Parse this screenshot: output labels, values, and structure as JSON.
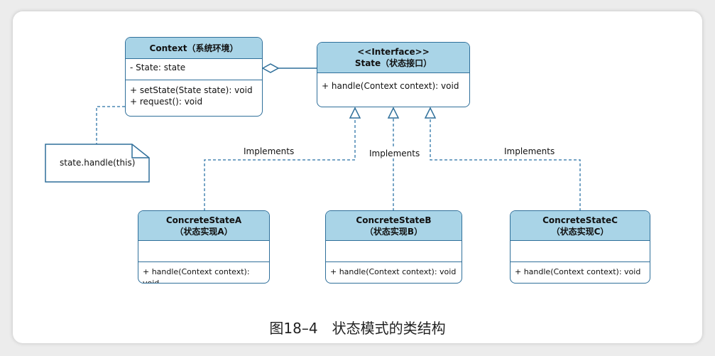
{
  "context": {
    "title": "Context（系统环境）",
    "attribute": "- State: state",
    "methods": [
      "+ setState(State state): void",
      "+ request(): void"
    ]
  },
  "state": {
    "stereotype": "<<Interface>>",
    "title": "State（状态接口）",
    "method": "+ handle(Context context): void"
  },
  "note": {
    "text": "state.handle(this)"
  },
  "implementations": [
    {
      "name": "ConcreteStateA",
      "subtitle": "（状态实现A）",
      "method": "+ handle(Context context): void",
      "edge_label": "Implements"
    },
    {
      "name": "ConcreteStateB",
      "subtitle": "（状态实现B）",
      "method": "+ handle(Context context): void",
      "edge_label": "Implements"
    },
    {
      "name": "ConcreteStateC",
      "subtitle": "（状态实现C）",
      "method": "+ handle(Context context): void",
      "edge_label": "Implements"
    }
  ],
  "caption": "图18–4　状态模式的类结构",
  "colors": {
    "header_fill": "#a9d4e7",
    "border": "#2f6f9a"
  }
}
